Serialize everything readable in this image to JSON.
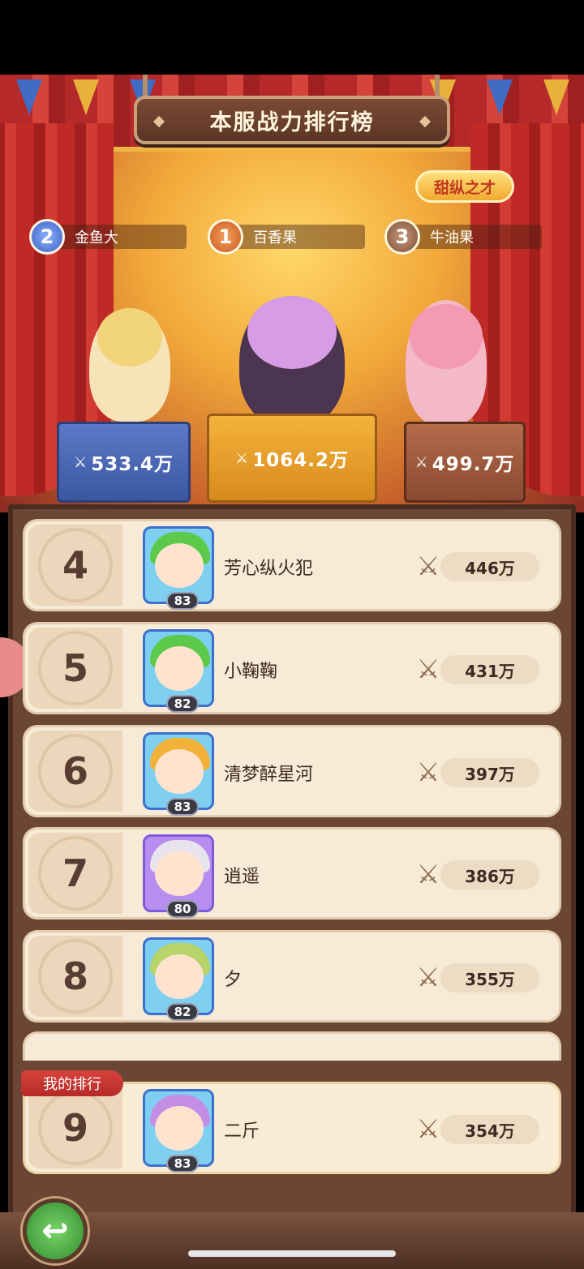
{
  "header": {
    "title": "本服战力排行榜",
    "badge": "甜纵之才"
  },
  "podium": [
    {
      "rank": "2",
      "name": "金鱼大",
      "power": "533.4万"
    },
    {
      "rank": "1",
      "name": "百香果",
      "power": "1064.2万"
    },
    {
      "rank": "3",
      "name": "牛油果",
      "power": "499.7万"
    }
  ],
  "list": [
    {
      "rank": "4",
      "name": "芳心纵火犯",
      "level": "83",
      "power": "446万",
      "hair": "#5cc94a"
    },
    {
      "rank": "5",
      "name": "小鞠鞠",
      "level": "82",
      "power": "431万",
      "hair": "#5cc94a"
    },
    {
      "rank": "6",
      "name": "清梦醉星河",
      "level": "83",
      "power": "397万",
      "hair": "#f2b23a"
    },
    {
      "rank": "7",
      "name": "逍遥",
      "level": "80",
      "power": "386万",
      "hair": "#e8e4ee"
    },
    {
      "rank": "8",
      "name": "夕",
      "level": "82",
      "power": "355万",
      "hair": "#b6d46a"
    }
  ],
  "mine": {
    "tag": "我的排行",
    "rank": "9",
    "name": "二斤",
    "level": "83",
    "power": "354万",
    "hair": "#c48ee6"
  },
  "icons": {
    "power": "crossed-swords-icon",
    "back": "back-arrow-icon"
  },
  "colors": {
    "accent": "#d8433c",
    "row_bg": "#f7ead7",
    "board": "#6b4634"
  }
}
